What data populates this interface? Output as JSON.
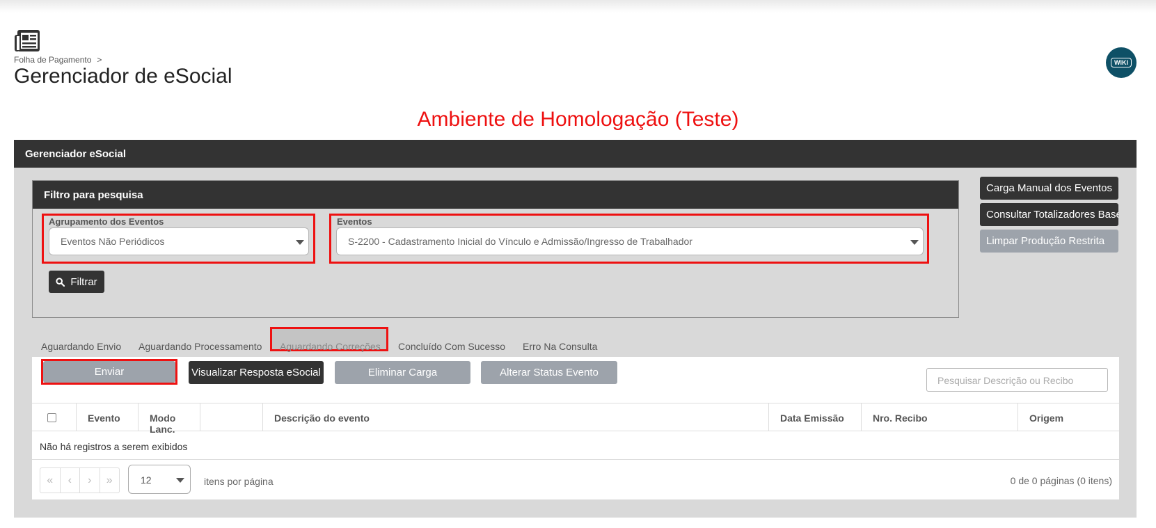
{
  "header": {
    "breadcrumb": "Folha de Pagamento",
    "breadcrumb_separator": ">",
    "title": "Gerenciador de eSocial",
    "page_icon": "newspaper-icon",
    "wiki_label": "WIKI"
  },
  "environment_banner": "Ambiente de Homologação (Teste)",
  "panel": {
    "title": "Gerenciador eSocial"
  },
  "filter": {
    "title": "Filtro para pesquisa",
    "grouping_label": "Agrupamento dos Eventos",
    "grouping_value": "Eventos Não Periódicos",
    "events_label": "Eventos",
    "events_value": "S-2200 - Cadastramento Inicial do Vínculo e Admissão/Ingresso de Trabalhador",
    "filter_button": "Filtrar"
  },
  "side_buttons": {
    "manual_load": "Carga Manual dos Eventos",
    "totalizers": "Consultar Totalizadores Base",
    "clear_restricted": "Limpar Produção Restrita"
  },
  "tabs": [
    {
      "label": "Aguardando Envio"
    },
    {
      "label": "Aguardando Processamento"
    },
    {
      "label": "Aguardando Correções"
    },
    {
      "label": "Concluído Com Sucesso"
    },
    {
      "label": "Erro Na Consulta"
    }
  ],
  "actions": {
    "send": "Enviar",
    "view_response": "Visualizar Resposta eSocial",
    "remove_load": "Eliminar Carga",
    "change_status": "Alterar Status Evento",
    "search_placeholder": "Pesquisar Descrição ou Recibo"
  },
  "grid": {
    "columns": [
      "Evento",
      "Modo Lanc.",
      "",
      "Descrição do evento",
      "Data Emissão",
      "Nro. Recibo",
      "Origem"
    ],
    "empty_message": "Não há registros a serem exibidos"
  },
  "pager": {
    "first": "«",
    "prev": "‹",
    "next": "›",
    "last": "»",
    "page_size": "12",
    "per_page_label": "itens por página",
    "info": "0 de 0 páginas (0 itens)"
  },
  "colors": {
    "dark_header": "#333333",
    "panel_bg": "#d9d9d9",
    "highlight_red": "#ee1111",
    "disabled_button": "#9da3ab",
    "wiki_bg": "#0e5066"
  }
}
